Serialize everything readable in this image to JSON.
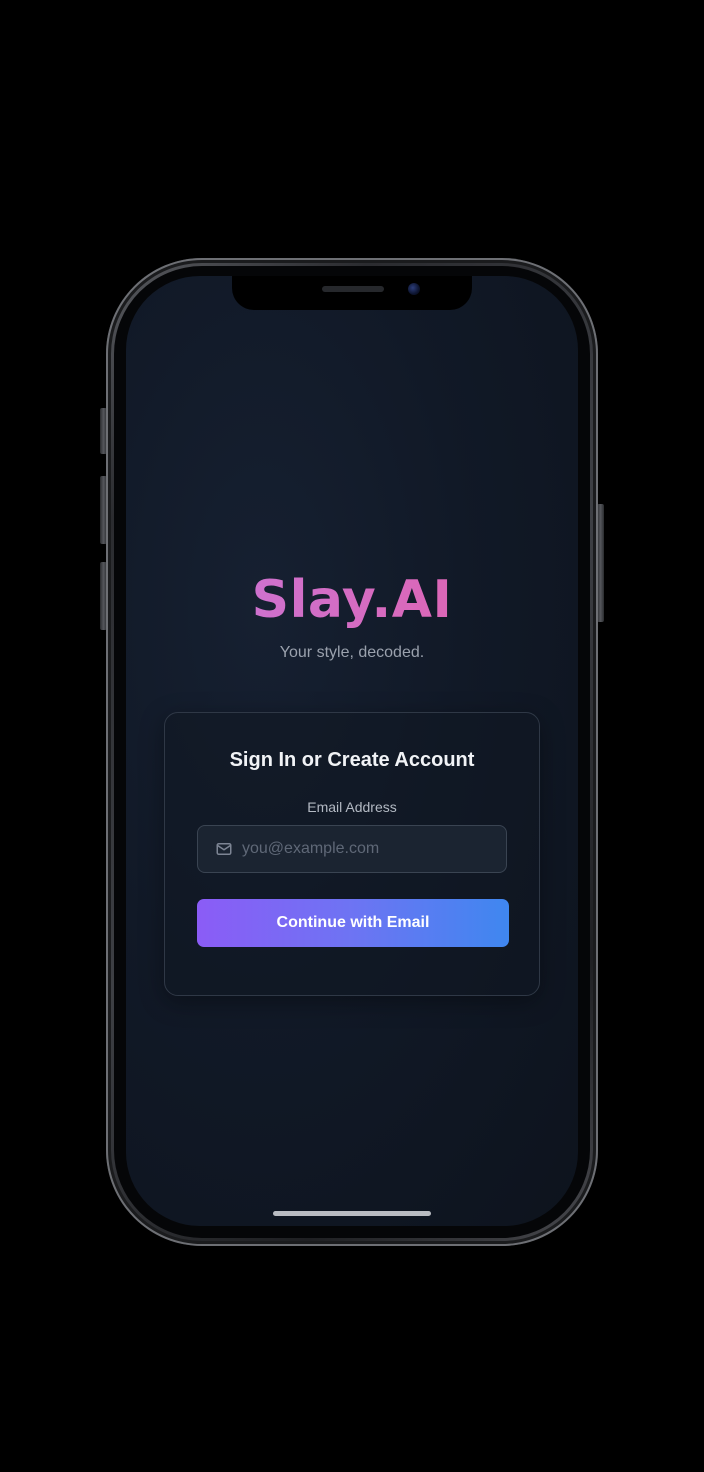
{
  "app": {
    "brand": "Slay.AI",
    "tagline": "Your style, decoded."
  },
  "auth_card": {
    "title": "Sign In or Create Account",
    "email_label": "Email Address",
    "email_placeholder": "you@example.com",
    "email_value": "",
    "email_icon": "mail-icon",
    "continue_label": "Continue with Email"
  },
  "colors": {
    "background": "#111927",
    "brand_gradient_start": "#c678dd",
    "brand_gradient_end": "#e55fa8",
    "button_gradient_start": "#8b5cf6",
    "button_gradient_end": "#3f87f0",
    "card_border": "#2f3846"
  }
}
